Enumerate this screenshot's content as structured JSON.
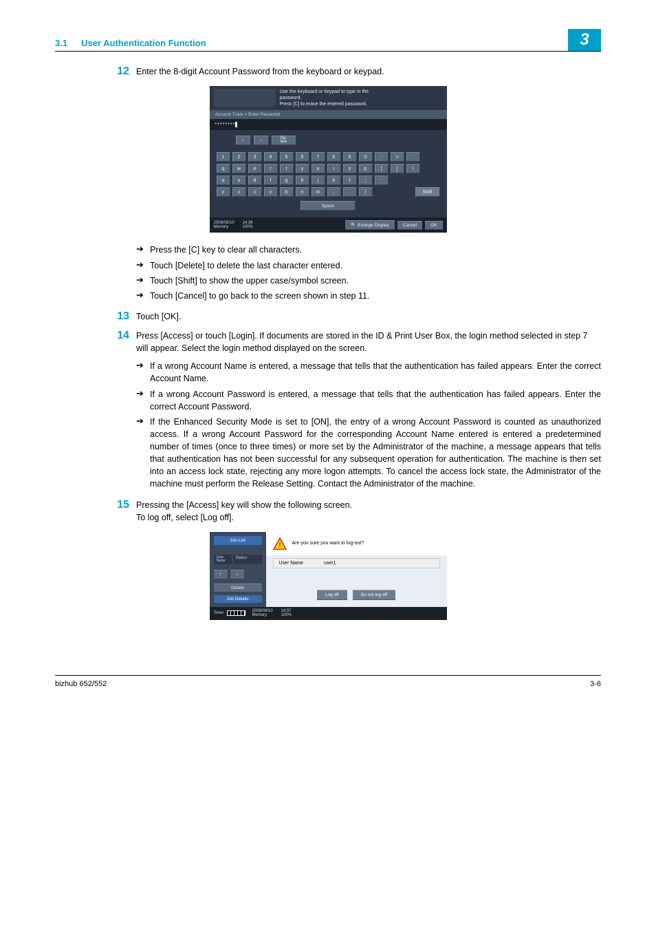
{
  "header": {
    "section_num": "3.1",
    "section_title": "User Authentication Function",
    "chapter_num": "3"
  },
  "step12": {
    "num": "12",
    "text": "Enter the 8-digit Account Password from the keyboard or keypad.",
    "bullets": [
      "Press the [C] key to clear all characters.",
      "Touch [Delete] to delete the last character entered.",
      "Touch [Shift] to show the upper case/symbol screen.",
      "Touch [Cancel] to go back to the screen shown in step 11."
    ]
  },
  "step13": {
    "num": "13",
    "text": "Touch [OK]."
  },
  "step14": {
    "num": "14",
    "text": "Press [Access] or touch [Login]. If documents are stored in the ID & Print User Box, the login method selected in step 7 will appear. Select the login method displayed on the screen.",
    "bullets": [
      "If a wrong Account Name is entered, a message that tells that the authentication has failed appears. Enter the correct Account Name.",
      "If a wrong Account Password is entered, a message that tells that the authentication has failed appears. Enter the correct Account Password.",
      "If the Enhanced Security Mode is set to [ON], the entry of a wrong Account Password is counted as unauthorized access. If a wrong Account Password for the corresponding Account Name entered is entered a predetermined number of times (once to three times) or more set by the Administrator of the machine, a message appears that tells that authentication has not been successful for any subsequent operation for authentication. The machine is then set into an access lock state, rejecting any more logon attempts. To cancel the access lock state, the Administrator of the machine must perform the Release Setting. Contact the Administrator of the machine."
    ]
  },
  "step15": {
    "num": "15",
    "line1": "Pressing the [Access] key will show the following screen.",
    "line2": "To log off, select [Log off]."
  },
  "kb": {
    "top_line1": "Use the keyboard or keypad to type in the",
    "top_line2": "password.",
    "top_line3": "Press [C] to erase the entered password.",
    "breadcrumb": "Account Track > Enter Password",
    "masked": "********",
    "delete_label": "De-\nlete",
    "row1": [
      "1",
      "2",
      "3",
      "4",
      "5",
      "6",
      "7",
      "8",
      "9",
      "0",
      "-",
      "=",
      "`"
    ],
    "row2": [
      "q",
      "w",
      "e",
      "r",
      "t",
      "y",
      "u",
      "i",
      "o",
      "p",
      "[",
      "]",
      "\\"
    ],
    "row3": [
      "a",
      "s",
      "d",
      "f",
      "g",
      "h",
      "j",
      "k",
      "l",
      ";",
      "'"
    ],
    "row4": [
      "z",
      "x",
      "c",
      "v",
      "b",
      "n",
      "m",
      ",",
      ".",
      "/"
    ],
    "shift": "Shift",
    "space": "Space",
    "date": "2009/09/10",
    "time": "14:36",
    "mem_label": "Memory",
    "mem_val": "100%",
    "enlarge": "Enlarge Display",
    "cancel": "Cancel",
    "ok": "OK"
  },
  "lo": {
    "job_list": "Job List",
    "user_hdr": "User Name",
    "status_hdr": "Status",
    "delete": "Delete",
    "job_details": "Job Details",
    "warn_text": "Are you sure you want to log-out?",
    "user_label": "User Name",
    "user_value": "user1",
    "log_off": "Log off",
    "do_not": "Do not log off",
    "toner": "Toner",
    "date": "2009/09/10",
    "time": "14:37",
    "mem_label": "Memory",
    "mem_val": "100%"
  },
  "footer": {
    "left": "bizhub 652/552",
    "right": "3-6"
  }
}
